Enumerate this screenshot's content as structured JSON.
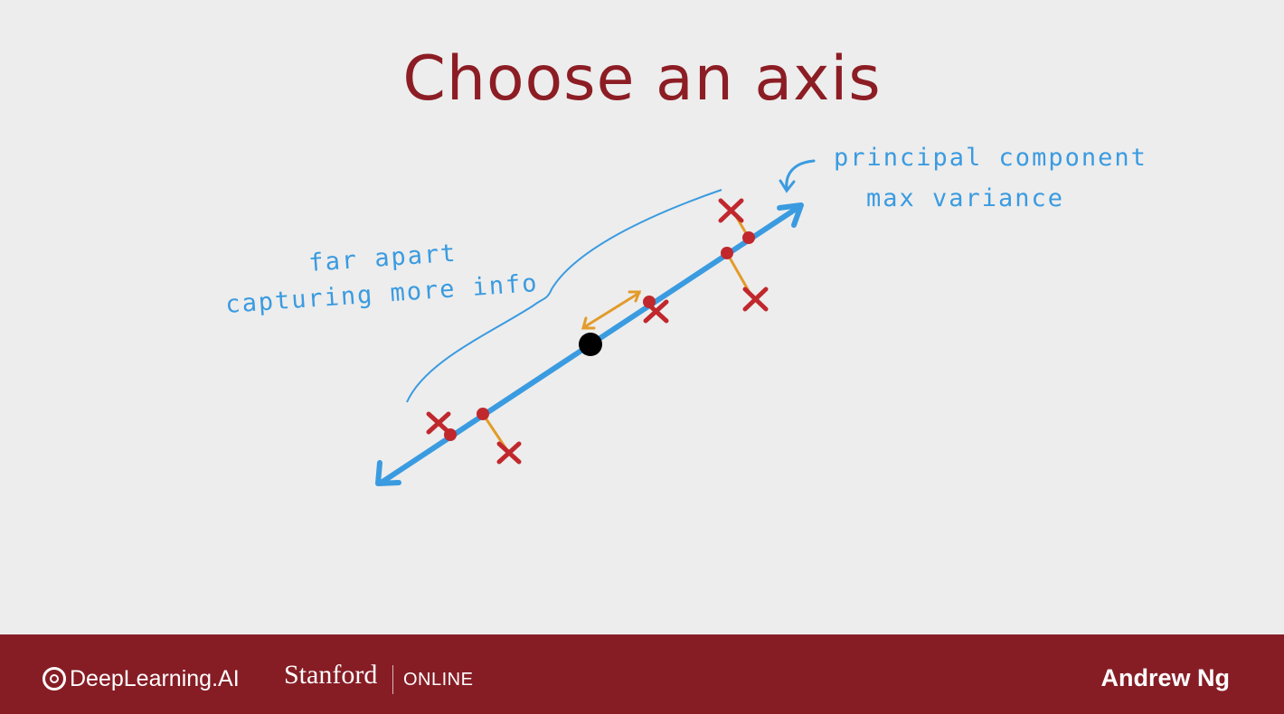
{
  "slide": {
    "title": "Choose an axis",
    "annotations": {
      "principal_line1": "principal component",
      "principal_line2": "max variance",
      "apart_line1": "far apart",
      "apart_line2": "capturing more info"
    }
  },
  "colors": {
    "title": "#8c1d24",
    "axis": "#3a9be0",
    "handwriting": "#3a9be0",
    "data_point_x": "#c0282d",
    "projection_dot": "#c0282d",
    "projection_line": "#e39b2a",
    "origin": "#000000",
    "footer": "#861d25"
  },
  "footer": {
    "brand": "DeepLearning.AI",
    "partner": "Stanford",
    "partner_suffix": "ONLINE",
    "author": "Andrew Ng"
  }
}
